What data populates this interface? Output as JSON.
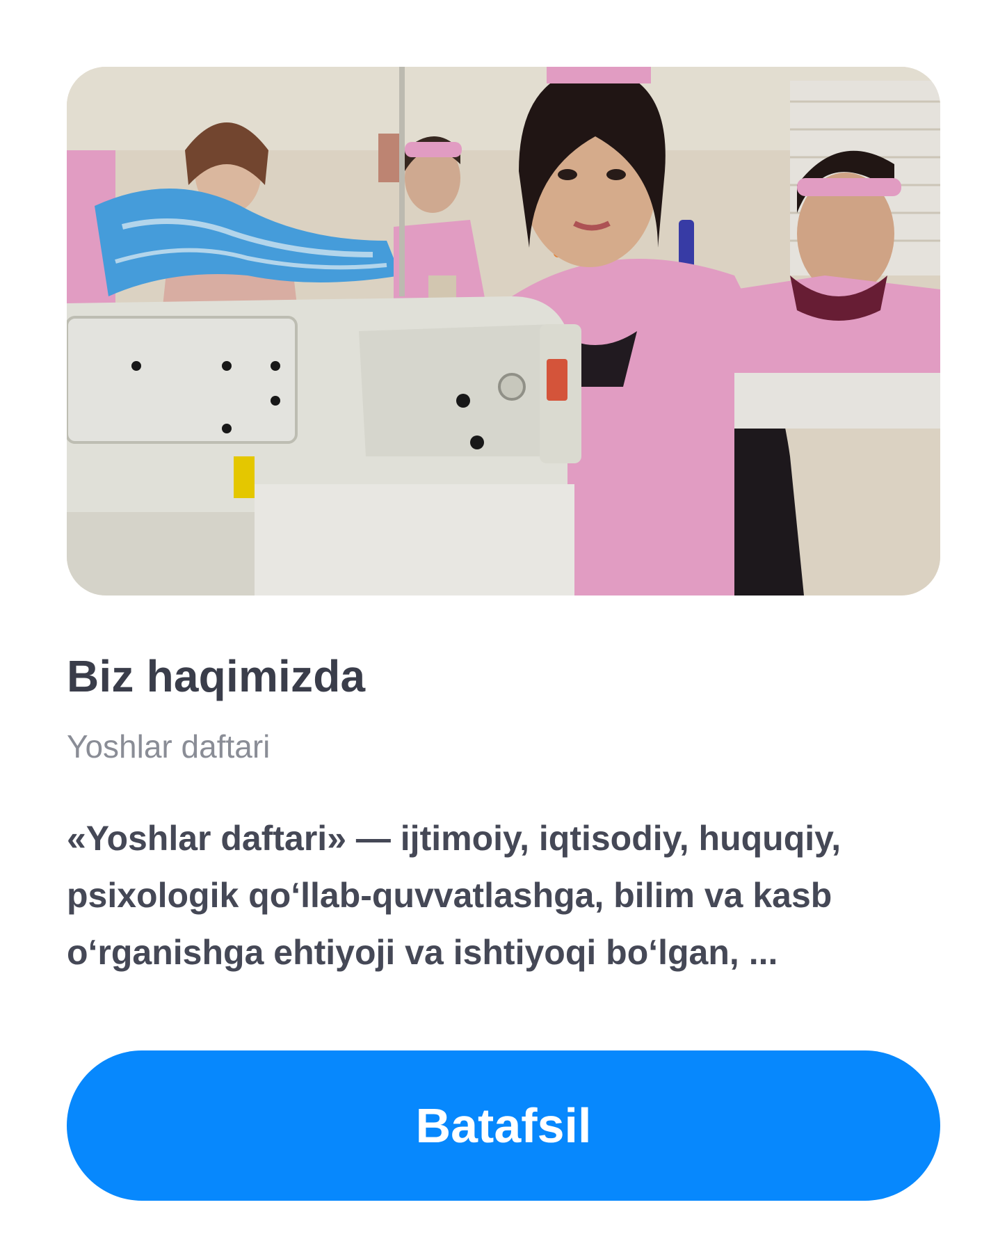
{
  "hero": {
    "image": "photo of young women in pink aprons working at sewing machines",
    "colors": {
      "apron_pink": "#f0a6cf",
      "machine_white": "#eeeee6",
      "wall": "#e9e0cf",
      "fabric_blue": "#4aa6e8"
    }
  },
  "about": {
    "title": "Biz haqimizda",
    "subtitle": "Yoshlar daftari",
    "description": "«Yoshlar daftari» — ijtimoiy, iqtisodiy, huquqiy, psixologik qo‘llab-quvvatlashga, bilim va kasb o‘rganishga ehtiyoji va ishtiyoqi bo‘lgan, ..."
  },
  "cta": {
    "label": "Batafsil",
    "color": "#0788fd"
  }
}
